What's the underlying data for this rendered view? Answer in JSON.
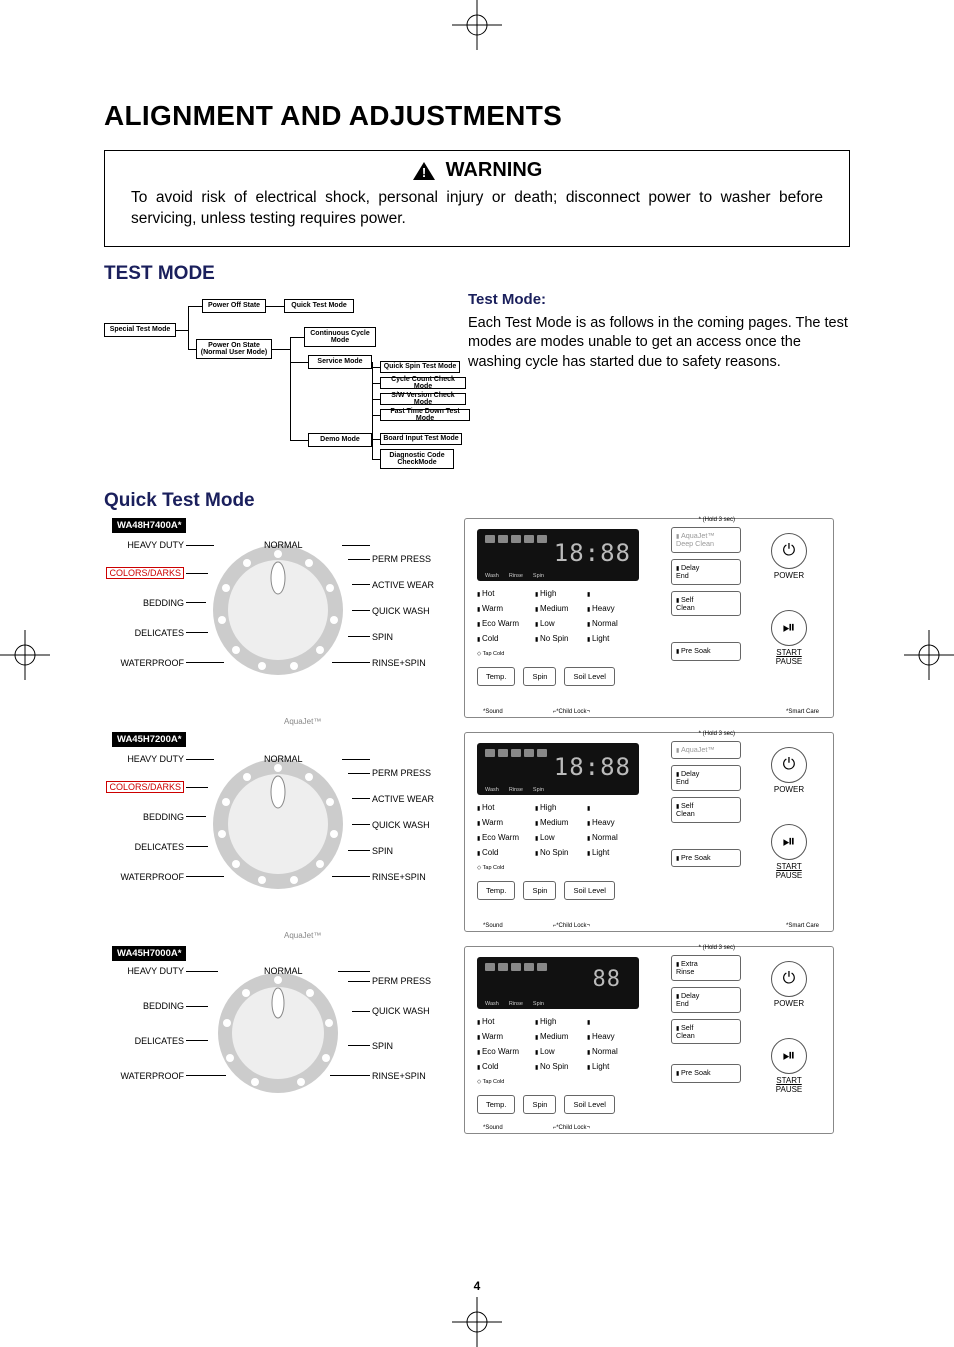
{
  "title": "ALIGNMENT AND ADJUSTMENTS",
  "warning": {
    "label": "WARNING",
    "text": "To avoid risk of electrical shock, personal injury or death; disconnect power to washer before servicing, unless testing requires power."
  },
  "test_mode_heading": "TEST MODE",
  "flowchart": {
    "n0": "Special Test Mode",
    "n1": "Power Off State",
    "n2": "Quick Test Mode",
    "n3": "Power On State\n(Normal User Mode)",
    "n4": "Continuous Cycle\nMode",
    "n5": "Service Mode",
    "n6": "Demo Mode",
    "n7": "Quick Spin Test Mode",
    "n8": "Cycle Count Check Mode",
    "n9": "S/W Version Check Mode",
    "n10": "Fast Time Down Test Mode",
    "n11": "Board Input Test Mode",
    "n12": "Diagnostic Code\nCheckMode"
  },
  "test_mode_col": {
    "heading": "Test Mode:",
    "body": "Each Test Mode is as follows in the coming pages. The test modes are modes unable to get an access once the washing cycle has started due to safety reasons."
  },
  "quick_heading": "Quick Test Mode",
  "dial_labels": {
    "normal": "NORMAL",
    "heavy": "HEAVY DUTY",
    "colors": "COLORS/DARKS",
    "bedding": "BEDDING",
    "delicates": "DELICATES",
    "waterproof": "WATERPROOF",
    "perm": "PERM PRESS",
    "active": "ACTIVE WEAR",
    "quickwash": "QUICK WASH",
    "spin": "SPIN",
    "rinse": "RINSE+SPIN",
    "aquajet": "AquaJet™"
  },
  "models": {
    "m1": "WA48H7400A*",
    "m2": "WA45H7200A*",
    "m3": "WA45H7000A*"
  },
  "panel": {
    "seg1": "18:88",
    "seg2": "18:88",
    "seg3": "88",
    "wash": "Wash",
    "rinse": "Rinse",
    "spinp": "Spin",
    "temp": {
      "hot": "Hot",
      "warm": "Warm",
      "eco": "Eco Warm",
      "cold": "Cold",
      "tap": "◇ Tap Cold"
    },
    "spin": {
      "high": "High",
      "med": "Medium",
      "low": "Low",
      "no": "No Spin"
    },
    "soil": {
      "heavy": "Heavy",
      "normal": "Normal",
      "light": "Light"
    },
    "btns": {
      "temp": "Temp.",
      "spin": "Spin",
      "soil": "Soil Level"
    },
    "side": {
      "aquadeep": "AquaJet™\nDeep Clean",
      "aqua": "AquaJet™",
      "delay": "Delay\nEnd",
      "self": "Self\nClean",
      "presoak": "Pre Soak",
      "extra": "Extra\nRinse"
    },
    "hold": "* (Hold 3 sec)",
    "sound": "*Sound",
    "childlock": "*Child Lock",
    "smart": "*Smart Care",
    "power": "POWER",
    "start": "START",
    "pause": "PAUSE"
  },
  "page_num": "4"
}
